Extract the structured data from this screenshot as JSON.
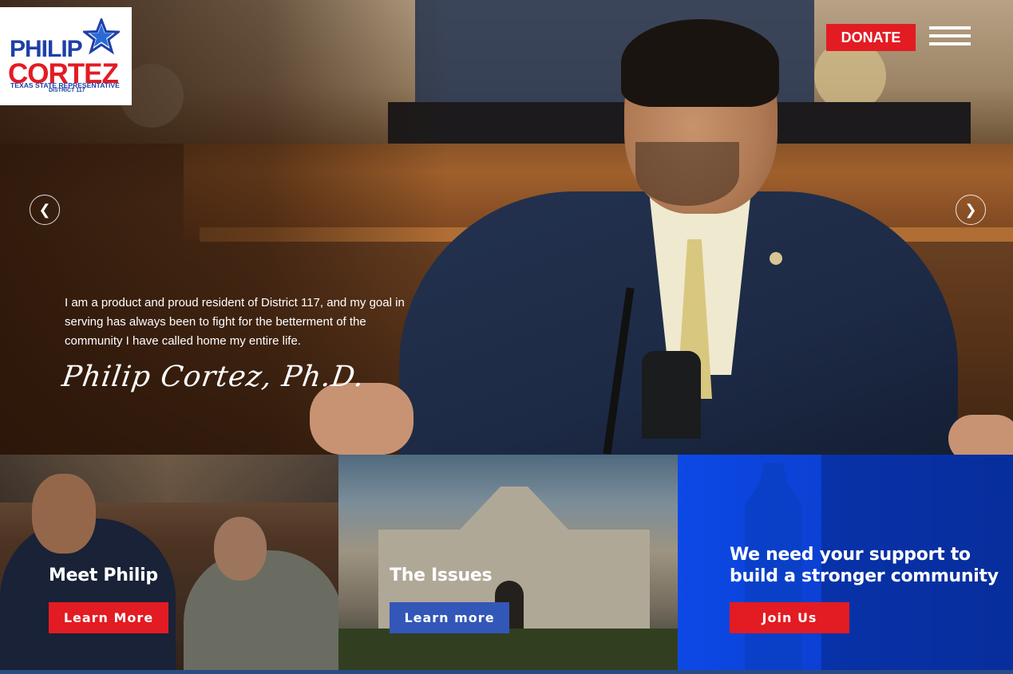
{
  "logo": {
    "line1": "PHILIP",
    "line2": "CORTEZ",
    "line3": "TEXAS STATE REPRESENTATIVE",
    "line4": "DISTRICT 117"
  },
  "header": {
    "donate_label": "DONATE",
    "menu_icon": "hamburger-menu-icon"
  },
  "hero": {
    "prev_icon": "chevron-left-icon",
    "next_icon": "chevron-right-icon",
    "quote": "I am a product and proud resident of District 117, and my goal in serving has always been to fight for the betterment of the community I have called home my entire life.",
    "signature": "Philip Cortez, Ph.D."
  },
  "cards": [
    {
      "title": "Meet Philip",
      "button": "Learn More"
    },
    {
      "title": "The Issues",
      "button": "Learn more"
    },
    {
      "title": "We need your support to build a stronger community",
      "button": "Join Us"
    }
  ],
  "colors": {
    "brand_red": "#e31b23",
    "brand_blue": "#1e3fa8",
    "card_blue": "#0b3fd0"
  }
}
